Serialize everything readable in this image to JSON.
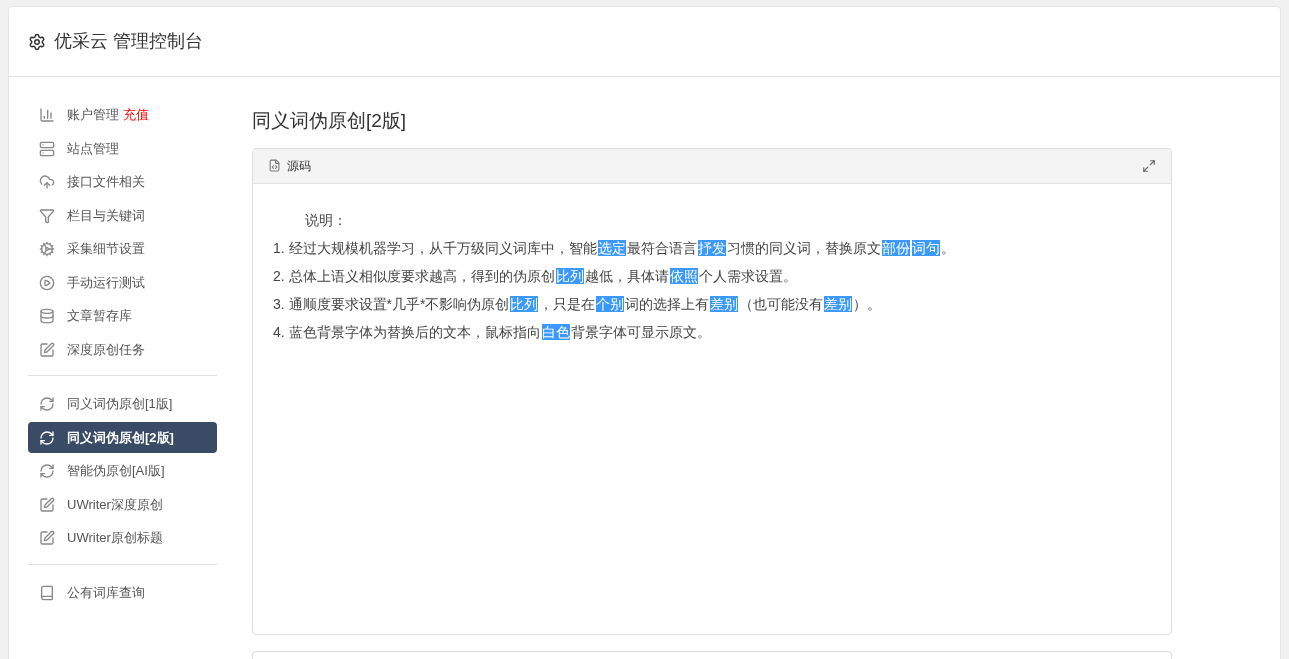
{
  "header": {
    "title": "优采云 管理控制台"
  },
  "sidebar": {
    "groups": [
      {
        "items": [
          {
            "kind": "chart",
            "label": "账户管理",
            "badge": "充值",
            "selected": false
          },
          {
            "kind": "server",
            "label": "站点管理",
            "selected": false
          },
          {
            "kind": "cloud",
            "label": "接口文件相关",
            "selected": false
          },
          {
            "kind": "filter",
            "label": "栏目与关键词",
            "selected": false
          },
          {
            "kind": "gears",
            "label": "采集细节设置",
            "selected": false
          },
          {
            "kind": "play",
            "label": "手动运行测试",
            "selected": false
          },
          {
            "kind": "database",
            "label": "文章暂存库",
            "selected": false
          },
          {
            "kind": "edit",
            "label": "深度原创任务",
            "selected": false
          }
        ]
      },
      {
        "items": [
          {
            "kind": "refresh",
            "label": "同义词伪原创[1版]",
            "selected": false
          },
          {
            "kind": "refresh",
            "label": "同义词伪原创[2版]",
            "selected": true
          },
          {
            "kind": "refresh",
            "label": "智能伪原创[AI版]",
            "selected": false
          },
          {
            "kind": "edit",
            "label": "UWriter深度原创",
            "selected": false
          },
          {
            "kind": "edit",
            "label": "UWriter原创标题",
            "selected": false
          }
        ]
      },
      {
        "items": [
          {
            "kind": "book",
            "label": "公有词库查询",
            "selected": false
          }
        ]
      }
    ]
  },
  "main": {
    "heading": "同义词伪原创[2版]",
    "panel": {
      "tab": "源码",
      "intro": "说明：",
      "lines": [
        [
          {
            "text": "1. 经过大规模机器学习，从千万级同义词库中，智能",
            "highlight": false
          },
          {
            "text": "选定",
            "highlight": true
          },
          {
            "text": "最符合语言",
            "highlight": false
          },
          {
            "text": "抒发",
            "highlight": true
          },
          {
            "text": "习惯的同义词，替换原文",
            "highlight": false
          },
          {
            "text": "部份",
            "highlight": true
          },
          {
            "text": "词句",
            "highlight": true
          },
          {
            "text": "。",
            "highlight": false
          }
        ],
        [
          {
            "text": "2. 总体上语义相似度要求越高，得到的伪原创",
            "highlight": false
          },
          {
            "text": "比列",
            "highlight": true
          },
          {
            "text": "越低，具体请",
            "highlight": false
          },
          {
            "text": "依照",
            "highlight": true
          },
          {
            "text": "个人需求设置。",
            "highlight": false
          }
        ],
        [
          {
            "text": "3. 通顺度要求设置*几乎*不影响伪原创",
            "highlight": false
          },
          {
            "text": "比列",
            "highlight": true
          },
          {
            "text": "，只是在",
            "highlight": false
          },
          {
            "text": "个别",
            "highlight": true
          },
          {
            "text": "词的选择上有",
            "highlight": false
          },
          {
            "text": "差别",
            "highlight": true
          },
          {
            "text": "（也可能没有",
            "highlight": false
          },
          {
            "text": "差别",
            "highlight": true
          },
          {
            "text": "）。",
            "highlight": false
          }
        ],
        [
          {
            "text": "4. 蓝色背景字体为替换后的文本，鼠标指向",
            "highlight": false
          },
          {
            "text": "白色",
            "highlight": true
          },
          {
            "text": "背景字体可显示原文。",
            "highlight": false
          }
        ]
      ]
    }
  }
}
